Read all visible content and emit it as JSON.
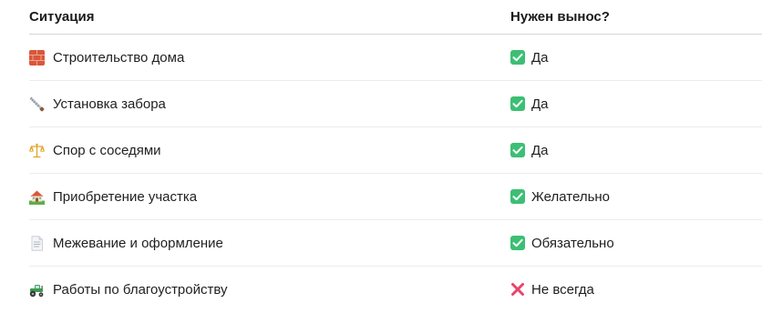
{
  "header": {
    "situation": "Ситуация",
    "needed": "Нужен вынос?"
  },
  "rows": [
    {
      "icon": "brick-icon",
      "situation": "Строительство дома",
      "status_icon": "check-icon",
      "answer": "Да"
    },
    {
      "icon": "saw-icon",
      "situation": "Установка забора",
      "status_icon": "check-icon",
      "answer": "Да"
    },
    {
      "icon": "scales-icon",
      "situation": "Спор с соседями",
      "status_icon": "check-icon",
      "answer": "Да"
    },
    {
      "icon": "house-icon",
      "situation": "Приобретение участка",
      "status_icon": "check-icon",
      "answer": "Желательно"
    },
    {
      "icon": "document-icon",
      "situation": "Межевание и оформление",
      "status_icon": "check-icon",
      "answer": "Обязательно"
    },
    {
      "icon": "tractor-icon",
      "situation": "Работы по благоустройству",
      "status_icon": "cross-icon",
      "answer": "Не всегда"
    }
  ],
  "colors": {
    "check": "#3cbf74",
    "cross": "#e8436a"
  }
}
